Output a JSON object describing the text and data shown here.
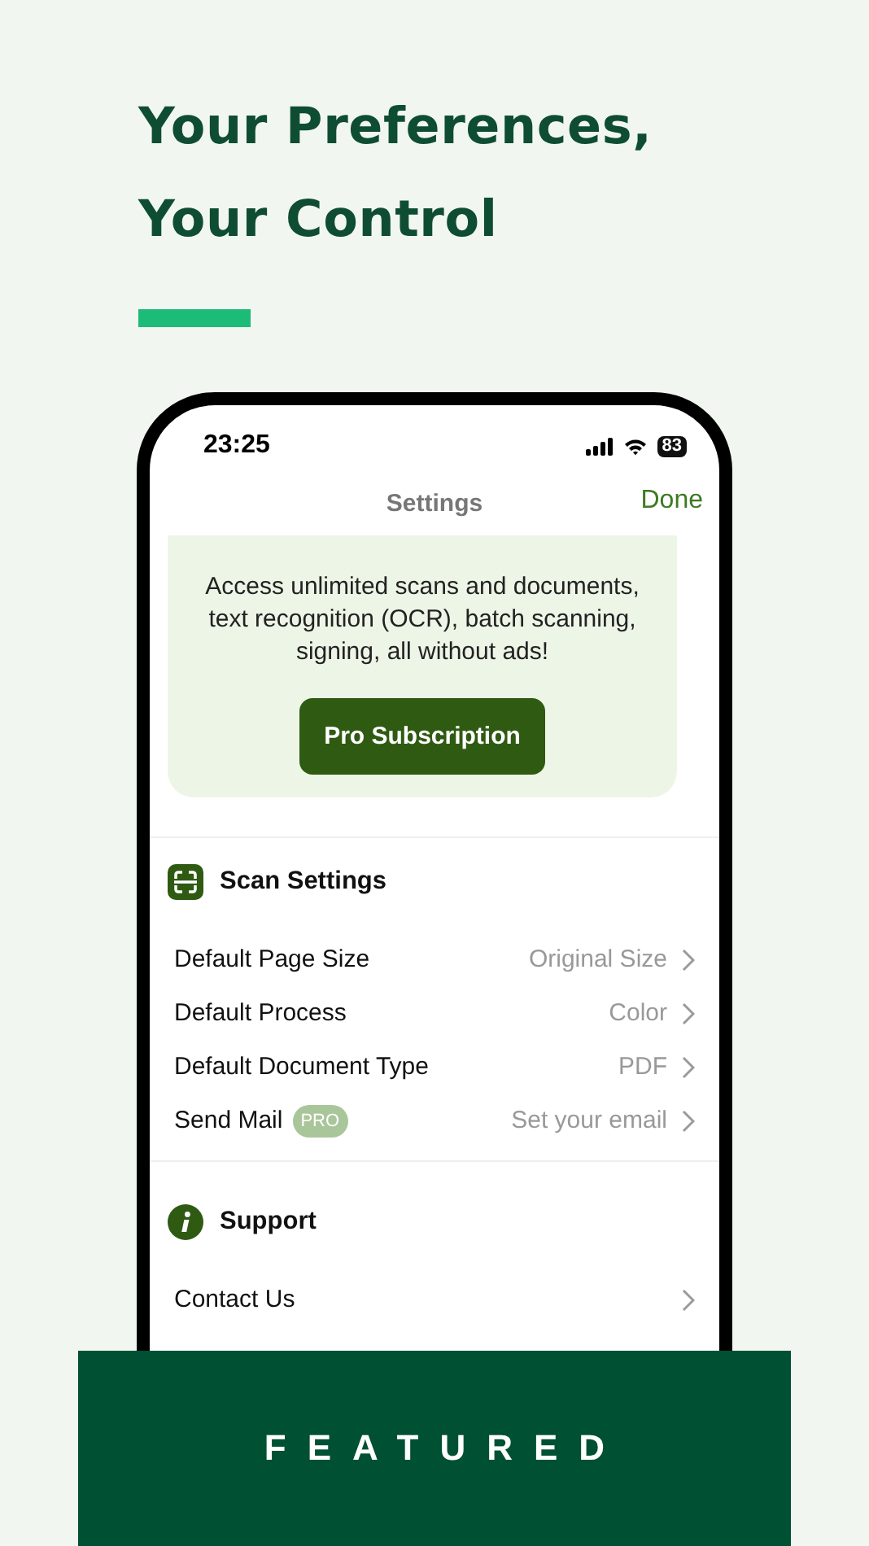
{
  "headline": [
    "Your Preferences,",
    "Your Control"
  ],
  "status_bar": {
    "time": "23:25",
    "battery": "83"
  },
  "nav": {
    "title": "Settings",
    "action": "Done"
  },
  "promo": {
    "text": "Access unlimited scans and documents, text recognition (OCR), batch scanning, signing, all without ads!",
    "button": "Pro Subscription"
  },
  "sections": [
    {
      "title": "Scan Settings",
      "rows": [
        {
          "label": "Default Page Size",
          "value": "Original Size"
        },
        {
          "label": "Default Process",
          "value": "Color"
        },
        {
          "label": "Default Document Type",
          "value": "PDF"
        },
        {
          "label": "Send Mail",
          "badge": "PRO",
          "value": "Set your email"
        }
      ]
    },
    {
      "title": "Support",
      "rows": [
        {
          "label": "Contact Us"
        }
      ]
    }
  ],
  "banner": "FEATURED"
}
